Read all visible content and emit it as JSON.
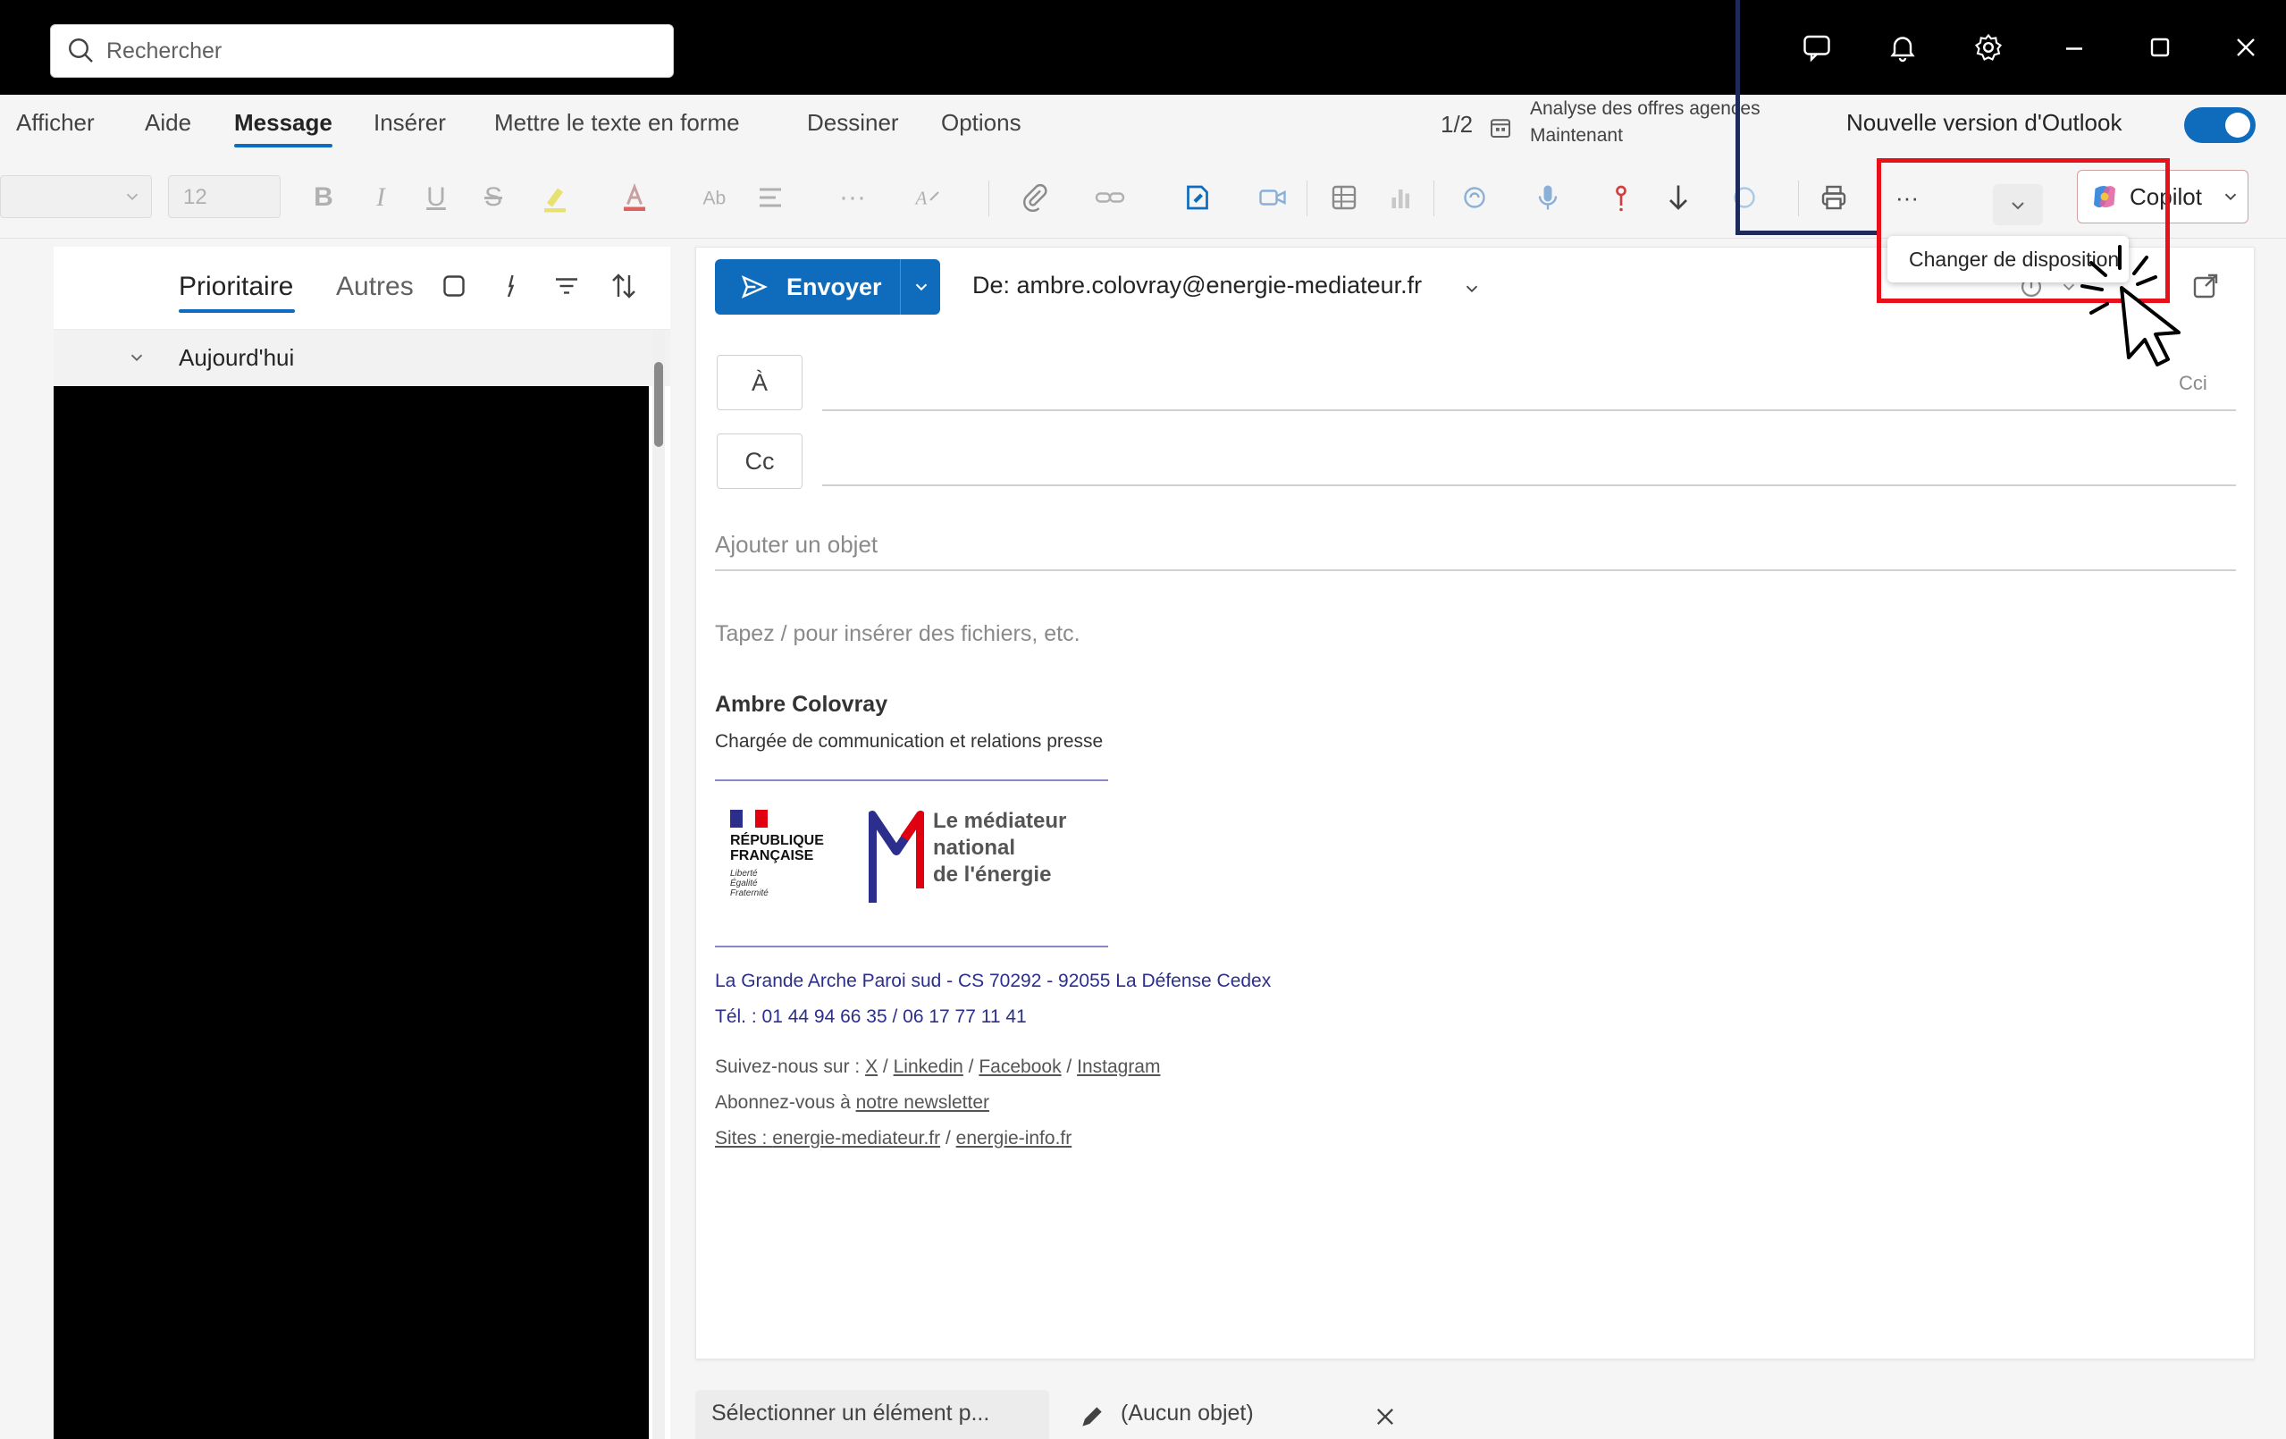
{
  "titlebar": {
    "search_placeholder": "Rechercher",
    "icons": [
      "chat-icon",
      "bell-icon",
      "settings-icon",
      "minimize-icon",
      "maximize-icon",
      "close-icon"
    ]
  },
  "menu": {
    "tabs": [
      "Afficher",
      "Aide",
      "Message",
      "Insérer",
      "Mettre le texte en forme",
      "Dessiner",
      "Options"
    ],
    "active_tab": "Message",
    "counter": "1/2",
    "notif_title": "Analyse des offres agences",
    "notif_time": "Maintenant",
    "new_outlook_label": "Nouvelle version d'Outlook",
    "toggle_on": true
  },
  "ribbon": {
    "font_size": "12",
    "bold": "B",
    "italic": "I",
    "underline": "U",
    "strike": "S",
    "more": "···",
    "copilot_label": "Copilot",
    "tooltip": "Changer de disposition"
  },
  "mail_list": {
    "tab_focused": "Prioritaire",
    "tab_other": "Autres",
    "group_today": "Aujourd'hui"
  },
  "compose": {
    "send_label": "Envoyer",
    "from": "De: ambre.colovray@energie-mediateur.fr",
    "to_label": "À",
    "cc_label": "Cc",
    "cci_label": "Cci",
    "subject_placeholder": "Ajouter un objet",
    "body_placeholder": "Tapez / pour insérer des fichiers, etc.",
    "signature": {
      "name": "Ambre Colovray",
      "role": "Chargée de communication et relations presse",
      "rf_line1": "RÉPUBLIQUE",
      "rf_line2": "FRANÇAISE",
      "rf_motto1": "Liberté",
      "rf_motto2": "Égalité",
      "rf_motto3": "Fraternité",
      "logo_line1": "Le médiateur",
      "logo_line2": "national",
      "logo_line3": "de l'énergie",
      "address": "La Grande Arche Paroi sud - CS 70292 - 92055 La Défense Cedex",
      "phone": "Tél. : 01 44 94 66 35 / 06 17 77 11 41",
      "follow_prefix": "Suivez-nous sur : ",
      "social_x": "X",
      "social_sep1": " / ",
      "social_linkedin": "Linkedin",
      "social_sep2": " / ",
      "social_facebook": "Facebook",
      "social_sep3": " / ",
      "social_instagram": "Instagram",
      "newsletter_prefix": "Abonnez-vous à ",
      "newsletter_link": "notre newsletter",
      "sites_prefix": "Sites : ",
      "site1": "energie-mediateur.fr",
      "site_sep": " / ",
      "site2": "energie-info.fr"
    }
  },
  "bottom": {
    "select_item": "Sélectionner un élément p...",
    "draft_subject": "(Aucun objet)"
  },
  "colors": {
    "accent": "#0f6cbd",
    "highlight_box": "#e8101a",
    "annotation_line": "#1e2a5a",
    "signature_blue": "#2b2e8c"
  }
}
